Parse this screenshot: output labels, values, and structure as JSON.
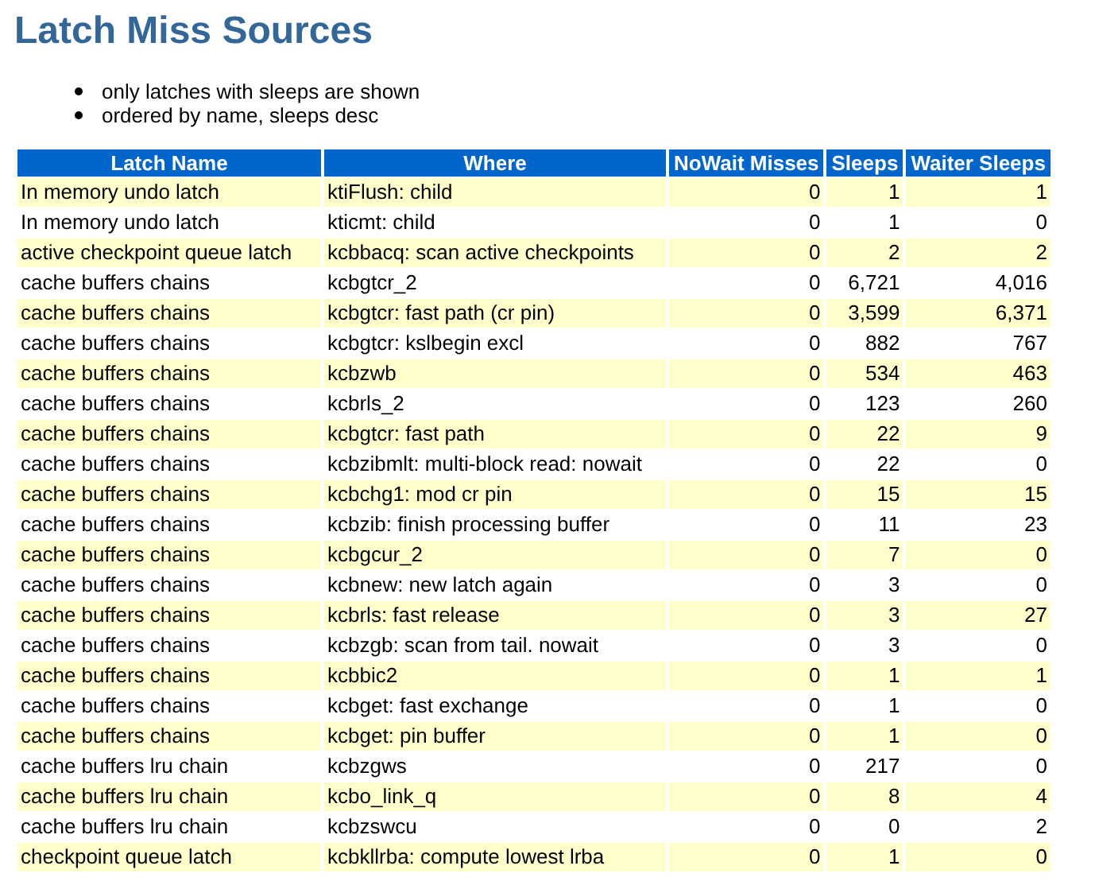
{
  "title": "Latch Miss Sources",
  "notes": [
    "only latches with sleeps are shown",
    "ordered by name, sleeps desc"
  ],
  "table": {
    "columns": [
      "Latch Name",
      "Where",
      "NoWait Misses",
      "Sleeps",
      "Waiter Sleeps"
    ],
    "rows": [
      [
        "In memory undo latch",
        "ktiFlush: child",
        "0",
        "1",
        "1"
      ],
      [
        "In memory undo latch",
        "kticmt: child",
        "0",
        "1",
        "0"
      ],
      [
        "active checkpoint queue latch",
        "kcbbacq: scan active checkpoints",
        "0",
        "2",
        "2"
      ],
      [
        "cache buffers chains",
        "kcbgtcr_2",
        "0",
        "6,721",
        "4,016"
      ],
      [
        "cache buffers chains",
        "kcbgtcr: fast path (cr pin)",
        "0",
        "3,599",
        "6,371"
      ],
      [
        "cache buffers chains",
        "kcbgtcr: kslbegin excl",
        "0",
        "882",
        "767"
      ],
      [
        "cache buffers chains",
        "kcbzwb",
        "0",
        "534",
        "463"
      ],
      [
        "cache buffers chains",
        "kcbrls_2",
        "0",
        "123",
        "260"
      ],
      [
        "cache buffers chains",
        "kcbgtcr: fast path",
        "0",
        "22",
        "9"
      ],
      [
        "cache buffers chains",
        "kcbzibmlt: multi-block read: nowait",
        "0",
        "22",
        "0"
      ],
      [
        "cache buffers chains",
        "kcbchg1: mod cr pin",
        "0",
        "15",
        "15"
      ],
      [
        "cache buffers chains",
        "kcbzib: finish processing buffer",
        "0",
        "11",
        "23"
      ],
      [
        "cache buffers chains",
        "kcbgcur_2",
        "0",
        "7",
        "0"
      ],
      [
        "cache buffers chains",
        "kcbnew: new latch again",
        "0",
        "3",
        "0"
      ],
      [
        "cache buffers chains",
        "kcbrls: fast release",
        "0",
        "3",
        "27"
      ],
      [
        "cache buffers chains",
        "kcbzgb: scan from tail. nowait",
        "0",
        "3",
        "0"
      ],
      [
        "cache buffers chains",
        "kcbbic2",
        "0",
        "1",
        "1"
      ],
      [
        "cache buffers chains",
        "kcbget: fast exchange",
        "0",
        "1",
        "0"
      ],
      [
        "cache buffers chains",
        "kcbget: pin buffer",
        "0",
        "1",
        "0"
      ],
      [
        "cache buffers lru chain",
        "kcbzgws",
        "0",
        "217",
        "0"
      ],
      [
        "cache buffers lru chain",
        "kcbo_link_q",
        "0",
        "8",
        "4"
      ],
      [
        "cache buffers lru chain",
        "kcbzswcu",
        "0",
        "0",
        "2"
      ],
      [
        "checkpoint queue latch",
        "kcbkllrba: compute lowest lrba",
        "0",
        "1",
        "0"
      ]
    ]
  }
}
